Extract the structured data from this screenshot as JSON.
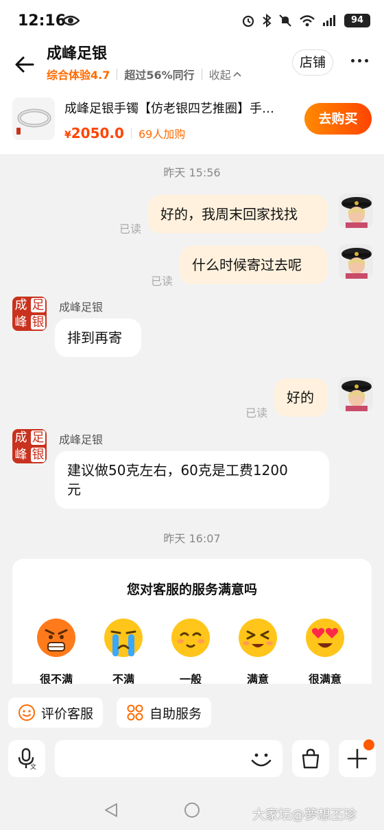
{
  "status_bar": {
    "time": "12:16",
    "battery": "94"
  },
  "header": {
    "shop_name": "成峰足银",
    "score": "综合体验4.7",
    "rank": "超过56%同行",
    "collapse": "收起",
    "shop_button": "店铺"
  },
  "product": {
    "title": "成峰足银手镯【仿老银四艺推圈】手…",
    "currency": "¥",
    "price": "2050.0",
    "cart_count": "69人加购",
    "buy_button": "去购买"
  },
  "chat": {
    "timestamp_1": "昨天  15:56",
    "msg_1": "好的，我周末回家找找",
    "msg_2": "什么时候寄过去呢",
    "msg_3": "排到再寄",
    "msg_4": "好的",
    "msg_5_line1": "建议做50克左右，60克是工费1200",
    "msg_5_line2": "元",
    "read_label": "已读",
    "sender": "成峰足银",
    "logo_chars": [
      "成",
      "足",
      "峰",
      "银"
    ],
    "timestamp_2": "昨天  16:07"
  },
  "survey": {
    "question": "您对客服的服务满意吗",
    "options": [
      "很不满",
      "不满",
      "一般",
      "满意",
      "很满意"
    ]
  },
  "quick_actions": {
    "rate": "评价客服",
    "self_service": "自助服务"
  },
  "watermark": "大家坛@夢想丕珍",
  "colors": {
    "accent": "#ff6a00",
    "price": "#ff4400",
    "my_bubble": "#fff1dd",
    "logo": "#c8321e"
  }
}
